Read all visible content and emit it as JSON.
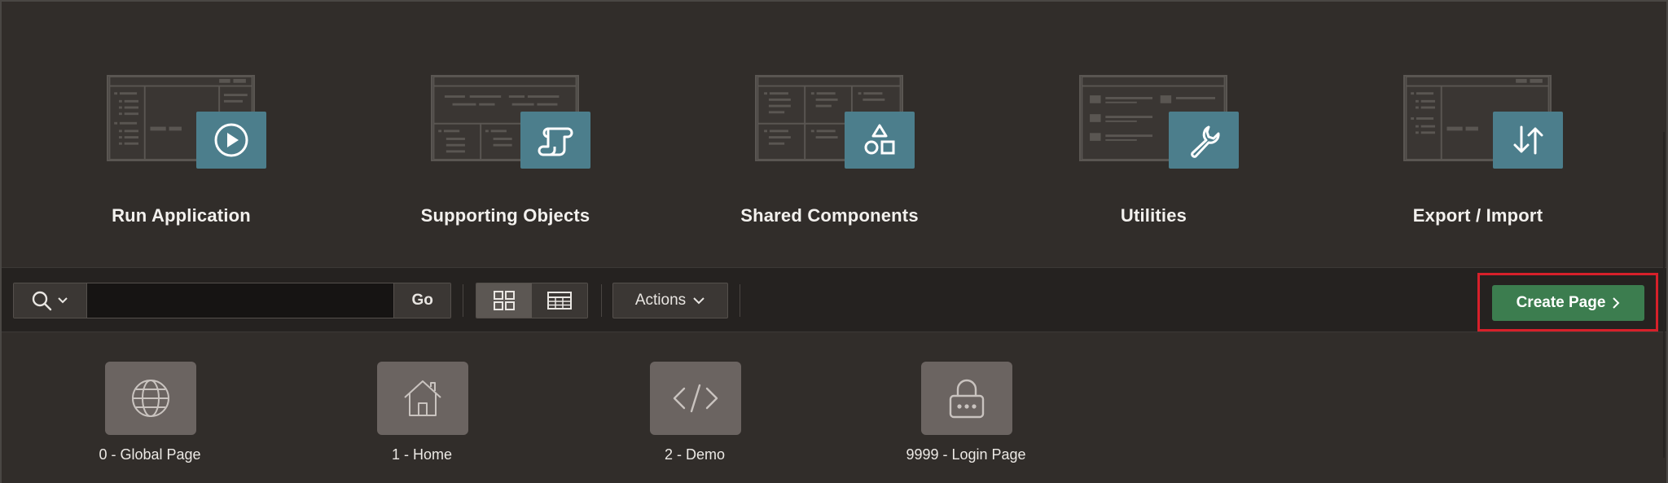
{
  "tiles": [
    {
      "label": "Run Application",
      "icon": "play-icon"
    },
    {
      "label": "Supporting Objects",
      "icon": "scroll-icon"
    },
    {
      "label": "Shared Components",
      "icon": "shapes-icon"
    },
    {
      "label": "Utilities",
      "icon": "wrench-icon"
    },
    {
      "label": "Export / Import",
      "icon": "arrows-up-down-icon"
    }
  ],
  "toolbar": {
    "search_value": "",
    "go_label": "Go",
    "actions_label": "Actions",
    "create_label": "Create Page"
  },
  "pages": [
    {
      "label": "0 - Global Page",
      "icon": "globe-icon"
    },
    {
      "label": "1 - Home",
      "icon": "home-icon"
    },
    {
      "label": "2 - Demo",
      "icon": "code-icon"
    },
    {
      "label": "9999 - Login Page",
      "icon": "lock-icon"
    }
  ],
  "colors": {
    "background": "#312d2a",
    "tile_badge": "#4c7e8c",
    "create_button": "#3c7d4f",
    "highlight_box": "#d7202a"
  }
}
